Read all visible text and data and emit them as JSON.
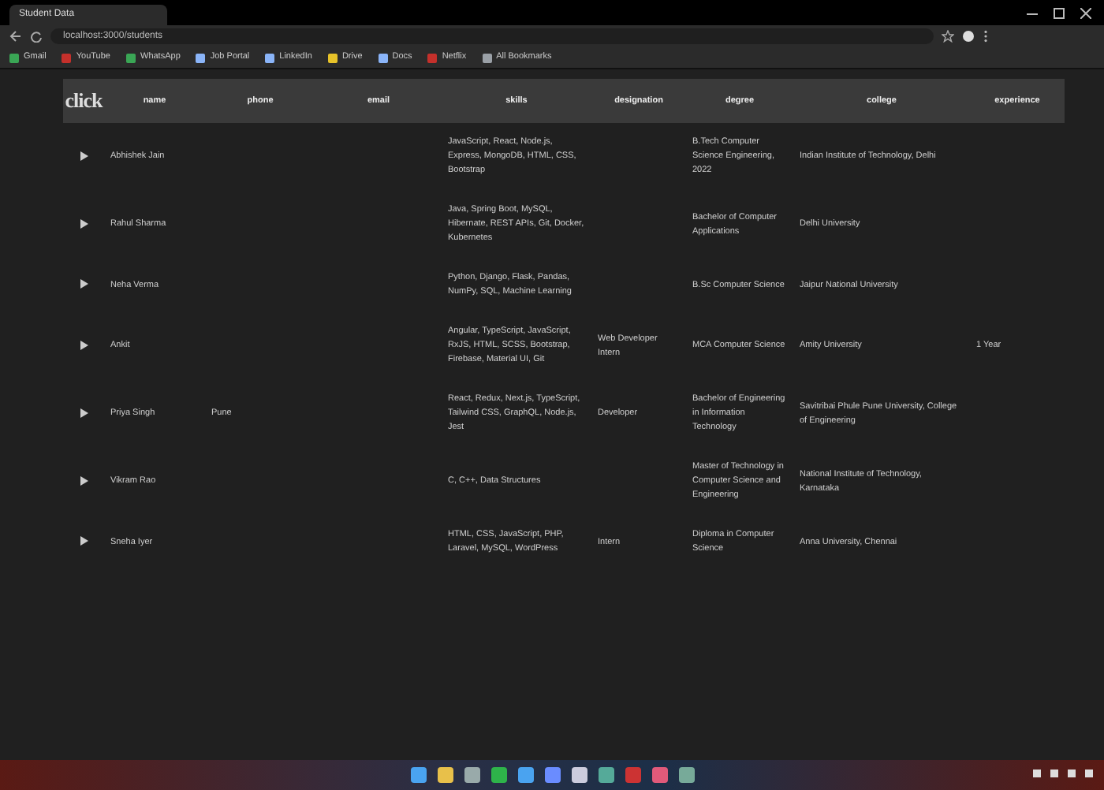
{
  "browser": {
    "tab_title": "Student Data",
    "url": "localhost:3000/students",
    "bookmarks": [
      {
        "label": "Gmail",
        "color": "#3aa655"
      },
      {
        "label": "YouTube",
        "color": "#c4302b"
      },
      {
        "label": "WhatsApp",
        "color": "#3aa655"
      },
      {
        "label": "Job Portal",
        "color": "#8ab4f8"
      },
      {
        "label": "LinkedIn",
        "color": "#8ab4f8"
      },
      {
        "label": "Drive",
        "color": "#e6c229"
      },
      {
        "label": "Docs",
        "color": "#8ab4f8"
      },
      {
        "label": "Netflix",
        "color": "#c4302b"
      },
      {
        "label": "All Bookmarks",
        "color": "#9aa0a6"
      }
    ]
  },
  "logo": "click",
  "table": {
    "columns": [
      "name",
      "phone",
      "email",
      "skills",
      "designation",
      "degree",
      "college",
      "experience"
    ],
    "rows": [
      {
        "name": "Abhishek Jain",
        "phone": "",
        "skills": "JavaScript, React, Node.js, Express, MongoDB, HTML, CSS, Bootstrap",
        "designation": "",
        "degree": "B.Tech Computer Science Engineering, 2022",
        "college": "Indian Institute of Technology, Delhi",
        "experience": ""
      },
      {
        "name": "Rahul Sharma",
        "phone": "",
        "skills": "Java, Spring Boot, MySQL, Hibernate, REST APIs, Git, Docker, Kubernetes",
        "designation": "",
        "degree": "Bachelor of Computer Applications",
        "college": "Delhi University",
        "experience": ""
      },
      {
        "name": "Neha Verma",
        "phone": "",
        "skills": "Python, Django, Flask, Pandas, NumPy, SQL, Machine Learning",
        "designation": "",
        "degree": "B.Sc Computer Science",
        "college": "Jaipur National University",
        "experience": ""
      },
      {
        "name": "Ankit",
        "phone": "",
        "skills": "Angular, TypeScript, JavaScript, RxJS, HTML, SCSS, Bootstrap, Firebase, Material UI, Git",
        "designation": "Web Developer Intern",
        "degree": "MCA Computer Science",
        "college": "Amity University",
        "experience": "1 Year"
      },
      {
        "name": "Priya Singh",
        "phone": "Pune",
        "skills": "React, Redux, Next.js, TypeScript, Tailwind CSS, GraphQL, Node.js, Jest",
        "designation": "Developer",
        "degree": "Bachelor of Engineering in Information Technology",
        "college": "Savitribai Phule Pune University, College of Engineering",
        "experience": ""
      },
      {
        "name": "Vikram Rao",
        "phone": "",
        "skills": "C, C++, Data Structures",
        "designation": "",
        "degree": "Master of Technology in Computer Science and Engineering",
        "college": "National Institute of Technology, Karnataka",
        "experience": ""
      },
      {
        "name": "Sneha Iyer",
        "phone": "",
        "skills": "HTML, CSS, JavaScript, PHP, Laravel, MySQL, WordPress",
        "designation": "Intern",
        "degree": "Diploma in Computer Science",
        "college": "Anna University, Chennai",
        "experience": ""
      }
    ]
  }
}
